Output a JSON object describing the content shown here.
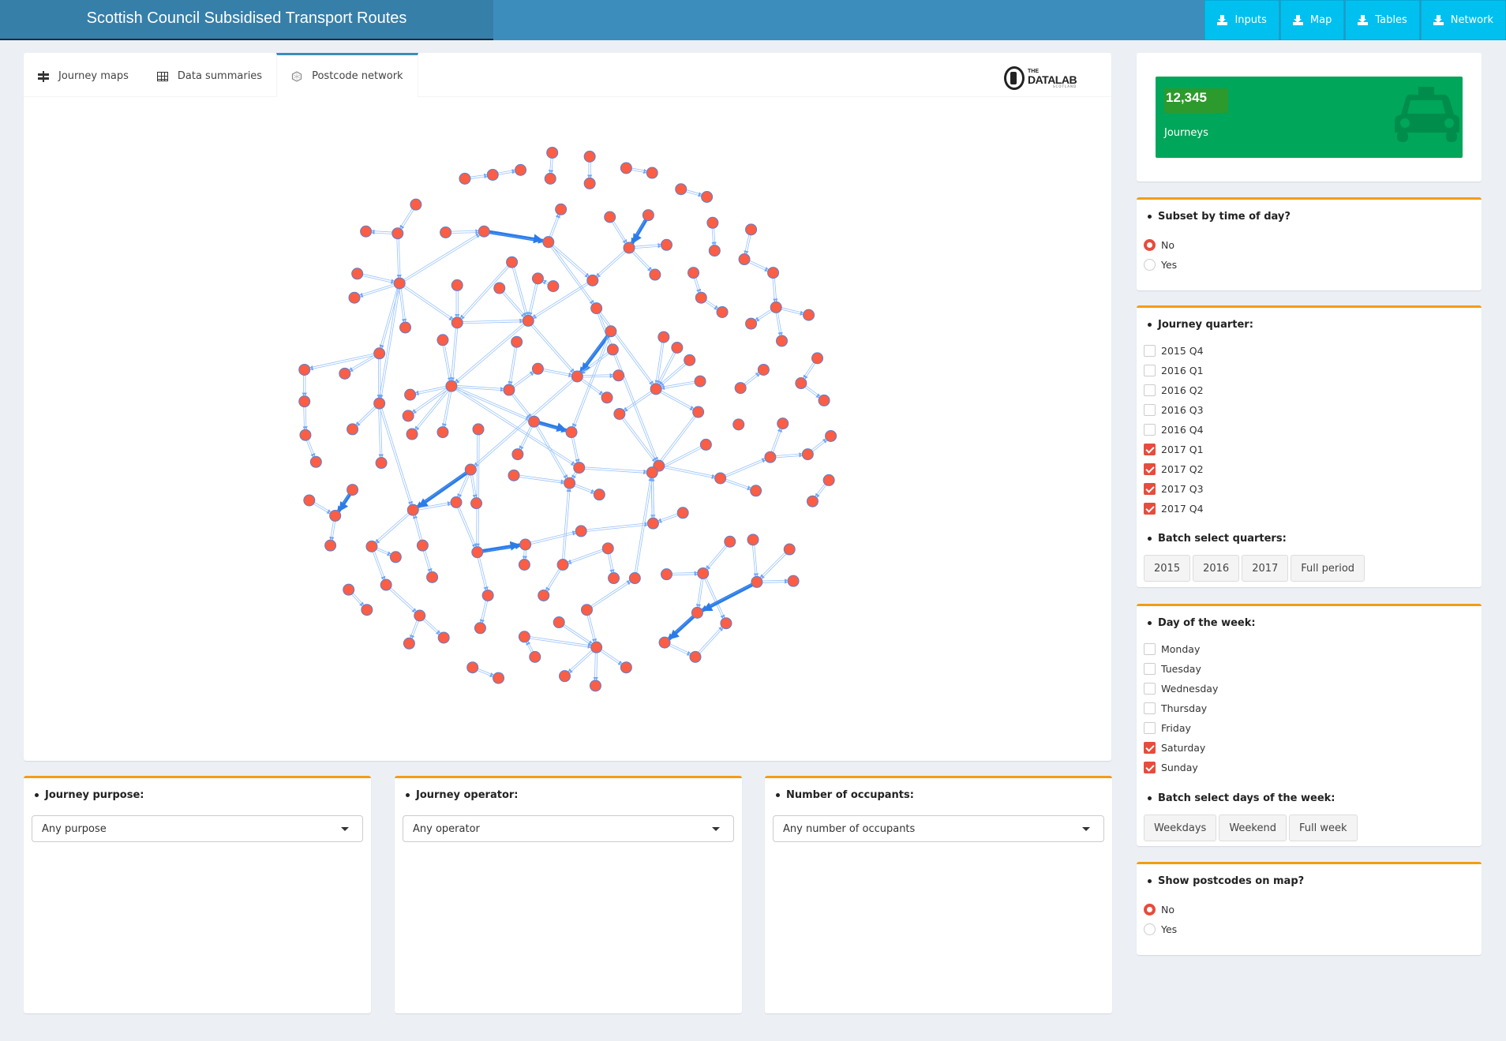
{
  "header": {
    "title": "Scottish Council Subsidised Transport Routes",
    "buttons": [
      {
        "label": "Inputs",
        "icon": "download-icon"
      },
      {
        "label": "Map",
        "icon": "download-icon"
      },
      {
        "label": "Tables",
        "icon": "download-icon"
      },
      {
        "label": "Network",
        "icon": "download-icon"
      }
    ]
  },
  "tabs": [
    {
      "label": "Journey maps",
      "icon": "map-signs-icon",
      "active": false
    },
    {
      "label": "Data summaries",
      "icon": "table-icon",
      "active": false
    },
    {
      "label": "Postcode network",
      "icon": "network-icon",
      "active": true
    }
  ],
  "logo": {
    "the": "THE",
    "main": "DATALAB",
    "sub": "SCOTLAND"
  },
  "network": {
    "node_color": "#fb5e45",
    "node_border_color": "#5a7fd0",
    "edge_color": "#97c2fc",
    "strong_edge_color": "#2b7ce9",
    "node_count": 155,
    "edges": [
      [
        1,
        2
      ],
      [
        3,
        4
      ],
      [
        5,
        6
      ],
      [
        6,
        7
      ],
      [
        8,
        9
      ],
      [
        10,
        11
      ],
      [
        12,
        13
      ],
      [
        13,
        14
      ],
      [
        13,
        33
      ],
      [
        15,
        16
      ],
      [
        16,
        17
      ],
      [
        17,
        18
      ],
      [
        17,
        39
      ],
      [
        17,
        40
      ],
      [
        33,
        16
      ],
      [
        19,
        21
      ],
      [
        20,
        21
      ],
      [
        21,
        22
      ],
      [
        21,
        23
      ],
      [
        21,
        39
      ],
      [
        24,
        25
      ],
      [
        26,
        27
      ],
      [
        27,
        41
      ],
      [
        41,
        42
      ],
      [
        42,
        43
      ],
      [
        42,
        44
      ],
      [
        42,
        45
      ],
      [
        28,
        29
      ],
      [
        29,
        30
      ],
      [
        31,
        47
      ],
      [
        32,
        33
      ],
      [
        33,
        34
      ],
      [
        33,
        46
      ],
      [
        33,
        48
      ],
      [
        33,
        57
      ],
      [
        33,
        73
      ],
      [
        35,
        46
      ],
      [
        36,
        47
      ],
      [
        37,
        47
      ],
      [
        38,
        37
      ],
      [
        39,
        47
      ],
      [
        46,
        47
      ],
      [
        46,
        60
      ],
      [
        47,
        60
      ],
      [
        47,
        63
      ],
      [
        40,
        65
      ],
      [
        40,
        97
      ],
      [
        31,
        46
      ],
      [
        49,
        60
      ],
      [
        50,
        61
      ],
      [
        51,
        63
      ],
      [
        52,
        63
      ],
      [
        51,
        84
      ],
      [
        53,
        65
      ],
      [
        54,
        65
      ],
      [
        55,
        65
      ],
      [
        56,
        65
      ],
      [
        65,
        77
      ],
      [
        65,
        76
      ],
      [
        57,
        58
      ],
      [
        57,
        59
      ],
      [
        57,
        73
      ],
      [
        58,
        72
      ],
      [
        72,
        78
      ],
      [
        78,
        91
      ],
      [
        60,
        61
      ],
      [
        60,
        74
      ],
      [
        60,
        75
      ],
      [
        60,
        80
      ],
      [
        60,
        81
      ],
      [
        60,
        83
      ],
      [
        60,
        96
      ],
      [
        61,
        62
      ],
      [
        61,
        83
      ],
      [
        62,
        63
      ],
      [
        63,
        64
      ],
      [
        63,
        66
      ],
      [
        63,
        94
      ],
      [
        67,
        68
      ],
      [
        69,
        70
      ],
      [
        70,
        71
      ],
      [
        73,
        79
      ],
      [
        73,
        92
      ],
      [
        73,
        105
      ],
      [
        76,
        97
      ],
      [
        77,
        98
      ],
      [
        97,
        99
      ],
      [
        99,
        101
      ],
      [
        99,
        89
      ],
      [
        89,
        86
      ],
      [
        89,
        90
      ],
      [
        90,
        87
      ],
      [
        88,
        98
      ],
      [
        82,
        117
      ],
      [
        83,
        84
      ],
      [
        83,
        93
      ],
      [
        83,
        108
      ],
      [
        84,
        96
      ],
      [
        94,
        105
      ],
      [
        94,
        106
      ],
      [
        94,
        107
      ],
      [
        95,
        108
      ],
      [
        96,
        108
      ],
      [
        96,
        98
      ],
      [
        98,
        112
      ],
      [
        108,
        109
      ],
      [
        100,
        110
      ],
      [
        102,
        104
      ],
      [
        103,
        104
      ],
      [
        104,
        113
      ],
      [
        105,
        106
      ],
      [
        105,
        114
      ],
      [
        106,
        117
      ],
      [
        114,
        115
      ],
      [
        114,
        124
      ],
      [
        116,
        123
      ],
      [
        116,
        105
      ],
      [
        117,
        118
      ],
      [
        117,
        135
      ],
      [
        118,
        119
      ],
      [
        118,
        122
      ],
      [
        119,
        112
      ],
      [
        120,
        125
      ],
      [
        120,
        121
      ],
      [
        121,
        136
      ],
      [
        121,
        108
      ],
      [
        111,
        112
      ],
      [
        112,
        98
      ],
      [
        124,
        139
      ],
      [
        139,
        144
      ],
      [
        139,
        145
      ],
      [
        127,
        131
      ],
      [
        128,
        132
      ],
      [
        129,
        132
      ],
      [
        130,
        131
      ],
      [
        131,
        141
      ],
      [
        131,
        142
      ],
      [
        132,
        133
      ],
      [
        132,
        141
      ],
      [
        141,
        149
      ],
      [
        149,
        151
      ],
      [
        151,
        142
      ],
      [
        134,
        138
      ],
      [
        135,
        140
      ],
      [
        137,
        147
      ],
      [
        143,
        147
      ],
      [
        146,
        147
      ],
      [
        147,
        150
      ],
      [
        147,
        152
      ],
      [
        147,
        153
      ],
      [
        137,
        126
      ],
      [
        126,
        98
      ],
      [
        154,
        155
      ],
      [
        148,
        143
      ]
    ],
    "strong_edges": [
      [
        83,
        84
      ],
      [
        94,
        105
      ],
      [
        117,
        118
      ],
      [
        102,
        104
      ],
      [
        20,
        21
      ],
      [
        132,
        141
      ],
      [
        141,
        149
      ],
      [
        16,
        17
      ],
      [
        63,
        51
      ]
    ]
  },
  "filters": {
    "purpose": {
      "label": "Journey purpose:",
      "value": "Any purpose"
    },
    "operator": {
      "label": "Journey operator:",
      "value": "Any operator"
    },
    "occupants": {
      "label": "Number of occupants:",
      "value": "Any number of occupants"
    }
  },
  "valuebox": {
    "value": "12,345",
    "label": "Journeys",
    "icon": "taxi-icon",
    "color": "#00a65a"
  },
  "time_of_day": {
    "label": "Subset by time of day?",
    "options": [
      {
        "label": "No",
        "selected": true
      },
      {
        "label": "Yes",
        "selected": false
      }
    ]
  },
  "quarters": {
    "label": "Journey quarter:",
    "options": [
      {
        "label": "2015 Q4",
        "checked": false
      },
      {
        "label": "2016 Q1",
        "checked": false
      },
      {
        "label": "2016 Q2",
        "checked": false
      },
      {
        "label": "2016 Q3",
        "checked": false
      },
      {
        "label": "2016 Q4",
        "checked": false
      },
      {
        "label": "2017 Q1",
        "checked": true
      },
      {
        "label": "2017 Q2",
        "checked": true
      },
      {
        "label": "2017 Q3",
        "checked": true
      },
      {
        "label": "2017 Q4",
        "checked": true
      }
    ],
    "batch_label": "Batch select quarters:",
    "batch_buttons": [
      "2015",
      "2016",
      "2017",
      "Full period"
    ]
  },
  "days": {
    "label": "Day of the week:",
    "options": [
      {
        "label": "Monday",
        "checked": false
      },
      {
        "label": "Tuesday",
        "checked": false
      },
      {
        "label": "Wednesday",
        "checked": false
      },
      {
        "label": "Thursday",
        "checked": false
      },
      {
        "label": "Friday",
        "checked": false
      },
      {
        "label": "Saturday",
        "checked": true
      },
      {
        "label": "Sunday",
        "checked": true
      }
    ],
    "batch_label": "Batch select days of the week:",
    "batch_buttons": [
      "Weekdays",
      "Weekend",
      "Full week"
    ]
  },
  "postcodes": {
    "label": "Show postcodes on map?",
    "options": [
      {
        "label": "No",
        "selected": true
      },
      {
        "label": "Yes",
        "selected": false
      }
    ]
  }
}
